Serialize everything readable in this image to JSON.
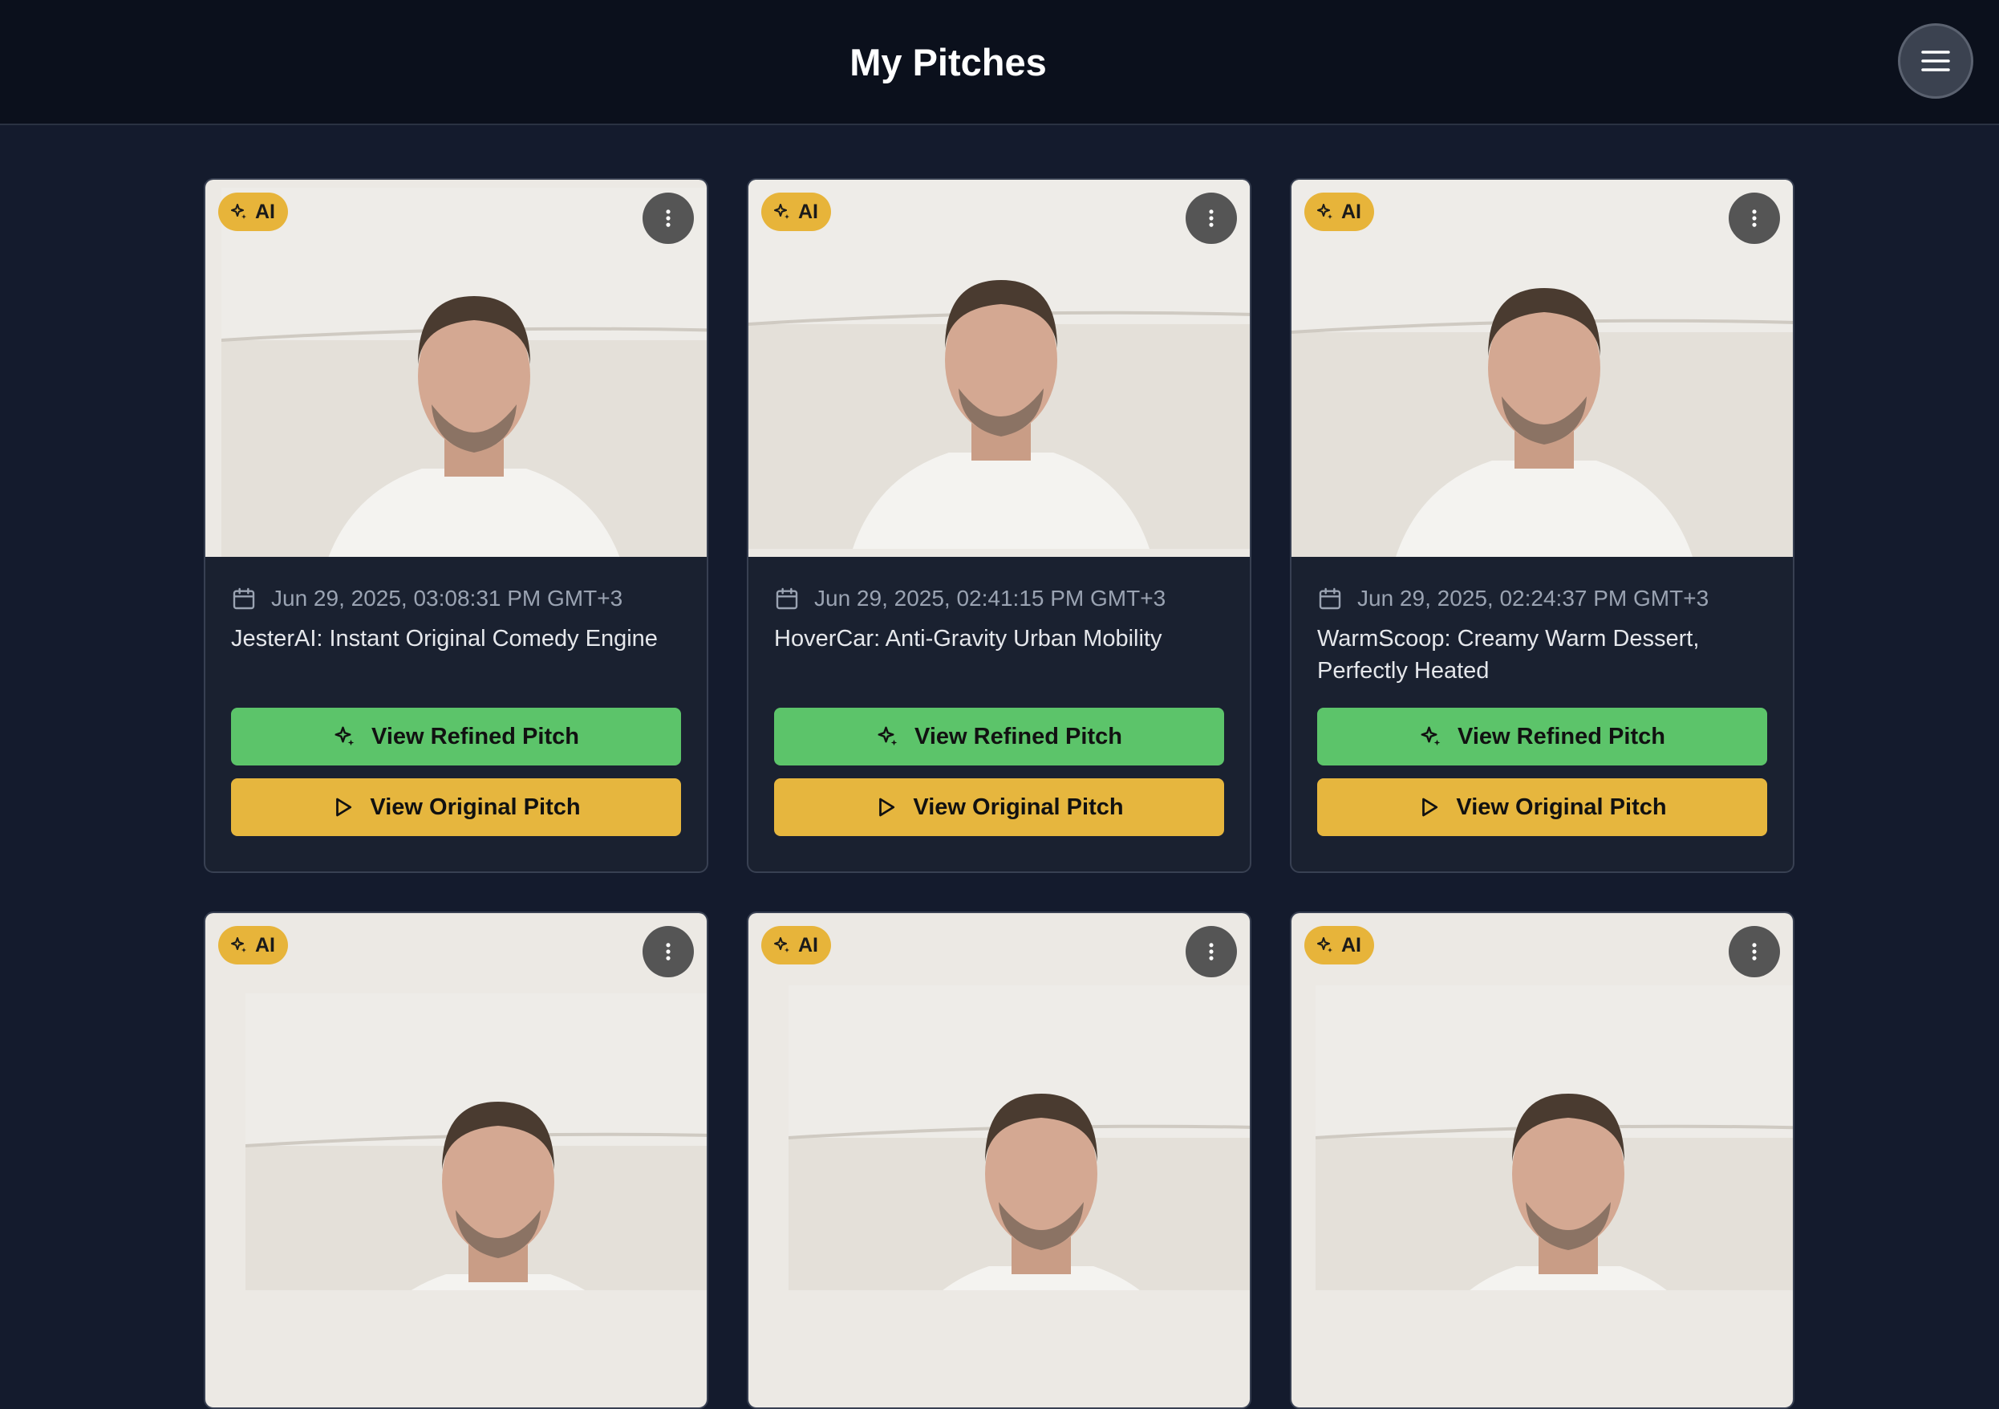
{
  "header": {
    "title": "My Pitches",
    "menu_icon": "hamburger-menu-icon"
  },
  "card_actions": {
    "badge_label": "AI",
    "refined_label": "View Refined Pitch",
    "original_label": "View Original Pitch"
  },
  "cards": [
    {
      "date": "Jun 29, 2025, 03:08:31 PM GMT+3",
      "title": "JesterAI: Instant Original Comedy Engine"
    },
    {
      "date": "Jun 29, 2025, 02:41:15 PM GMT+3",
      "title": "HoverCar: Anti-Gravity Urban Mobility"
    },
    {
      "date": "Jun 29, 2025, 02:24:37 PM GMT+3",
      "title": "WarmScoop: Creamy Warm Dessert, Perfectly Heated"
    }
  ],
  "colors": {
    "background": "#141b2d",
    "header": "#0b101c",
    "card": "#1a2130",
    "badge": "#e7b43a",
    "refined_button": "#5cc46a",
    "original_button": "#e6b63e"
  }
}
